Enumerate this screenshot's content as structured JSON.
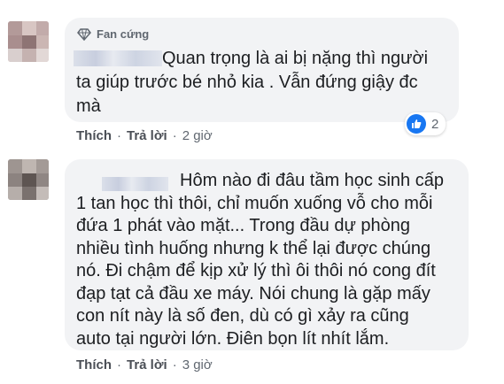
{
  "comments": [
    {
      "badge": "Fan cứng",
      "lines": [
        "Quan trọng là ai bị nặng thì người",
        "ta giúp trước bé nhỏ kia . Vẫn đứng giậy đc",
        "mà"
      ],
      "reaction_count": "2",
      "like_label": "Thích",
      "reply_label": "Trả lời",
      "time": "2 giờ"
    },
    {
      "lines": [
        "Hôm nào đi đâu tầm học sinh cấp",
        "1 tan học thì thôi, chỉ muốn xuống vỗ cho mỗi",
        "đứa 1 phát vào mặt... Trong đầu dự phòng",
        "nhiều tình huống nhưng k thể lại được chúng",
        "nó. Đi chậm để kịp xử lý thì ôi thôi nó cong đít",
        "đạp tạt cả đầu xe máy. Nói chung là gặp mấy",
        "con nít này là số đen, dù có gì xảy ra cũng",
        "auto tại người lớn. Điên bọn lít nhít lắm."
      ],
      "like_label": "Thích",
      "reply_label": "Trả lời",
      "time": "3 giờ"
    }
  ],
  "colors": {
    "bubble": "#f2f3f5",
    "like_blue": "#1877f2",
    "meta_gray": "#606770"
  },
  "icons": [
    "diamond-icon",
    "like-icon"
  ]
}
